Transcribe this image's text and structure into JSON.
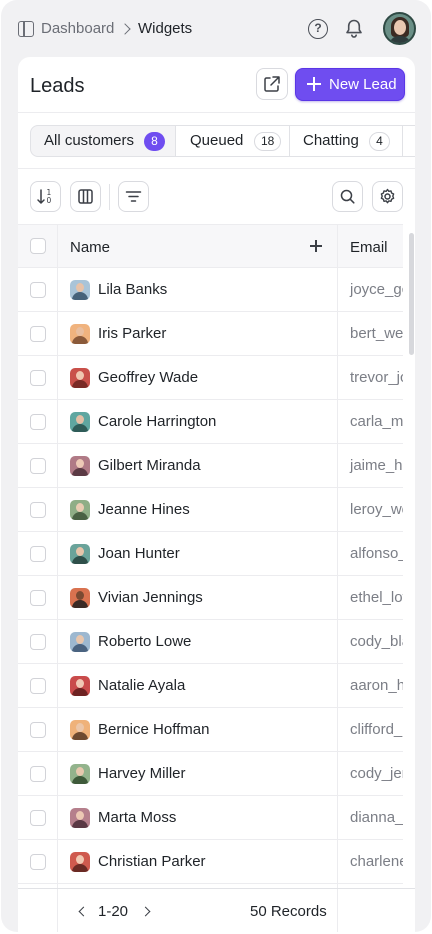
{
  "breadcrumb": {
    "root": "Dashboard",
    "current": "Widgets"
  },
  "header_icons": [
    "sidebar-toggle-icon",
    "help-icon",
    "bell-icon"
  ],
  "page": {
    "title": "Leads",
    "new_button": "New Lead"
  },
  "tabs": [
    {
      "label": "All customers",
      "count": "8",
      "active": true
    },
    {
      "label": "Queued",
      "count": "18",
      "active": false
    },
    {
      "label": "Chatting",
      "count": "4",
      "active": false
    }
  ],
  "toolbar_icons": [
    "sort-icon",
    "columns-icon",
    "filter-icon",
    "search-icon",
    "settings-icon"
  ],
  "table": {
    "columns": [
      "Name",
      "Email"
    ],
    "rows": [
      {
        "name": "Lila Banks",
        "email": "joyce_gc"
      },
      {
        "name": "Iris Parker",
        "email": "bert_we"
      },
      {
        "name": "Geoffrey Wade",
        "email": "trevor_jc"
      },
      {
        "name": "Carole Harrington",
        "email": "carla_ma"
      },
      {
        "name": "Gilbert Miranda",
        "email": "jaime_hu"
      },
      {
        "name": "Jeanne Hines",
        "email": "leroy_we"
      },
      {
        "name": "Joan Hunter",
        "email": "alfonso_"
      },
      {
        "name": "Vivian Jennings",
        "email": "ethel_lov"
      },
      {
        "name": "Roberto Lowe",
        "email": "cody_bla"
      },
      {
        "name": "Natalie Ayala",
        "email": "aaron_he"
      },
      {
        "name": "Bernice Hoffman",
        "email": "clifford_"
      },
      {
        "name": "Harvey Miller",
        "email": "cody_jer"
      },
      {
        "name": "Marta Moss",
        "email": "dianna_p"
      },
      {
        "name": "Christian Parker",
        "email": "charlene"
      }
    ]
  },
  "pagination": {
    "range": "1-20",
    "records": "50 Records"
  },
  "colors": {
    "accent": "#6f4df0",
    "border": "#e1e2e6",
    "muted_text": "#7b7e86"
  }
}
